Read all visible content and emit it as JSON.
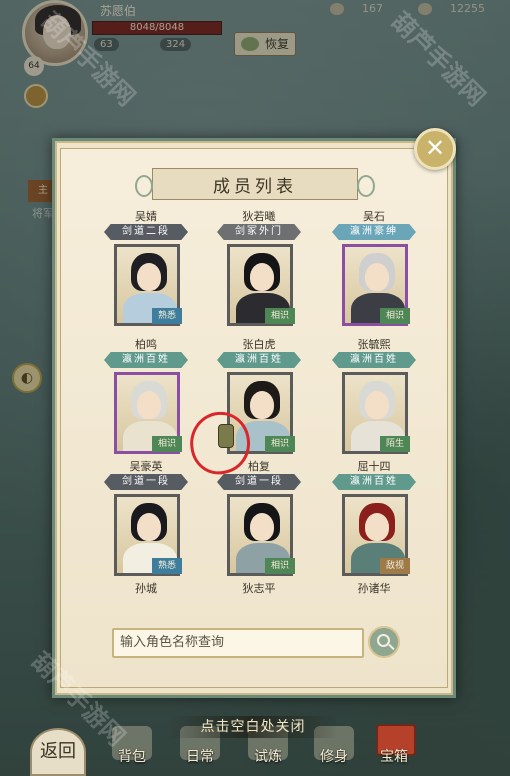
{
  "hud": {
    "player_name": "苏愿伯",
    "hp": "8048/8048",
    "stat_a": "63",
    "stat_b": "324",
    "level": "64",
    "restore_label": "恢复",
    "currency_a": "167",
    "currency_b": "12255"
  },
  "panel": {
    "title": "成员列表",
    "close_icon": "close-x-icon",
    "search_placeholder": "输入角色名称查询"
  },
  "members": [
    {
      "name": "吴婧",
      "rank": "剑道二段",
      "rank_style": "sword",
      "tag": "熟悉",
      "tag_style": "blue",
      "frame": "gray",
      "hair": "#1f1e22",
      "robe": "#b6cddd"
    },
    {
      "name": "狄若曦",
      "rank": "剑冢外门",
      "rank_style": "sect",
      "tag": "相识",
      "tag_style": "green",
      "frame": "gray",
      "hair": "#151517",
      "robe": "#2c2c30"
    },
    {
      "name": "吴石",
      "rank": "瀛洲豪绅",
      "rank_style": "official",
      "tag": "相识",
      "tag_style": "green",
      "frame": "purple",
      "hair": "#cfcfcf",
      "robe": "#3b3f45"
    },
    {
      "name": "柏鸣",
      "rank": "瀛洲百姓",
      "rank_style": "people",
      "tag": "相识",
      "tag_style": "green",
      "frame": "purple",
      "hair": "#d9d9d6",
      "robe": "#e9e2cf"
    },
    {
      "name": "张白虎",
      "rank": "瀛洲百姓",
      "rank_style": "people",
      "tag": "相识",
      "tag_style": "green",
      "frame": "gray",
      "hair": "#1d1a18",
      "robe": "#a9c1c9"
    },
    {
      "name": "张毓熙",
      "rank": "瀛洲百姓",
      "rank_style": "people",
      "tag": "陌生",
      "tag_style": "green",
      "frame": "gray",
      "hair": "#d8d8d4",
      "robe": "#e6e2d8"
    },
    {
      "name": "吴豪英",
      "rank": "剑道一段",
      "rank_style": "sword",
      "tag": "熟悉",
      "tag_style": "blue",
      "frame": "gray",
      "hair": "#1a1a1e",
      "robe": "#f2eee2"
    },
    {
      "name": "柏复",
      "rank": "剑道一段",
      "rank_style": "sword",
      "tag": "相识",
      "tag_style": "green",
      "frame": "gray",
      "hair": "#151517",
      "robe": "#8ea2a6"
    },
    {
      "name": "屈十四",
      "rank": "瀛洲百姓",
      "rank_style": "people",
      "tag": "敌视",
      "tag_style": "brown",
      "frame": "gray",
      "hair": "#8a1f1c",
      "robe": "#5a7e78"
    }
  ],
  "bottom_names": [
    "孙城",
    "狄志平",
    "孙诸华"
  ],
  "footer": {
    "tap_close": "点击空白处关闭",
    "back": "返回",
    "nav": [
      "背包",
      "日常",
      "试炼",
      "修身",
      "宝箱"
    ]
  },
  "side": {
    "badge": "主",
    "tag_a": "主",
    "label": "将军"
  }
}
